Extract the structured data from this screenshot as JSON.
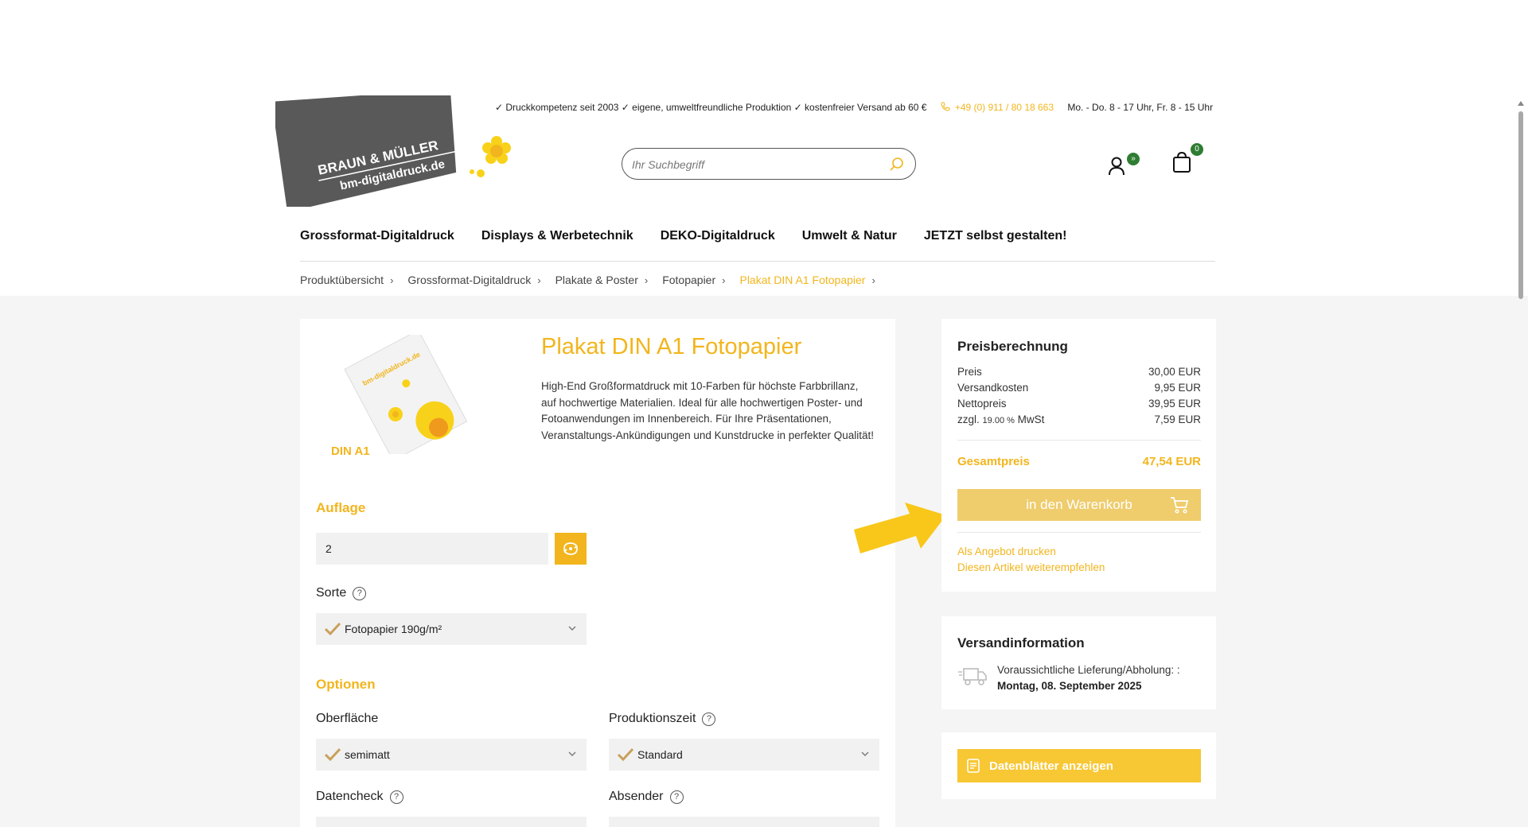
{
  "header": {
    "logo_line1": "BRAUN & MÜLLER",
    "logo_line2": "bm-digitaldruck.de",
    "tagline": "✓ Druckkompetenz seit 2003 ✓ eigene, umweltfreundliche Produktion ✓ kostenfreier Versand ab 60 €",
    "phone": "+49 (0) 911 / 80 18 663",
    "hours": "Mo. - Do. 8 - 17 Uhr, Fr. 8 - 15 Uhr",
    "search_placeholder": "Ihr Suchbegriff",
    "account_badge": "»",
    "cart_count": "0"
  },
  "nav": {
    "items": [
      "Grossformat-Digitaldruck",
      "Displays & Werbetechnik",
      "DEKO-Digitaldruck",
      "Umwelt & Natur",
      "JETZT selbst gestalten!"
    ]
  },
  "breadcrumb": {
    "items": [
      "Produktübersicht",
      "Grossformat-Digitaldruck",
      "Plakate & Poster",
      "Fotopapier",
      "Plakat DIN A1 Fotopapier"
    ]
  },
  "product": {
    "image_label": "DIN A1",
    "title": "Plakat DIN A1 Fotopapier",
    "description": "High-End Großformatdruck mit 10-Farben für höchste Farbbrillanz, auf hochwertige Materialien. Ideal für alle hochwertigen Poster- und Fotoanwendungen im Innenbereich. Für Ihre Präsentationen, Veranstaltungs-Ankündigungen und Kunstdrucke in perfekter Qualität!",
    "auflage_title": "Auflage",
    "auflage_value": "2",
    "sorte_label": "Sorte",
    "sorte_value": "Fotopapier 190g/m²",
    "optionen_title": "Optionen",
    "oberflaeche_label": "Oberfläche",
    "oberflaeche_value": "semimatt",
    "produktionszeit_label": "Produktionszeit",
    "produktionszeit_value": "Standard",
    "datencheck_label": "Datencheck",
    "absender_label": "Absender"
  },
  "price": {
    "title": "Preisberechnung",
    "rows": [
      {
        "label": "Preis",
        "value": "30,00 EUR"
      },
      {
        "label": "Versandkosten",
        "value": "9,95 EUR"
      },
      {
        "label": "Nettopreis",
        "value": "39,95 EUR"
      }
    ],
    "vat_prefix": "zzgl.",
    "vat_rate": "19.00 %",
    "vat_suffix": "MwSt",
    "vat_value": "7,59 EUR",
    "total_label": "Gesamtpreis",
    "total_value": "47,54 EUR",
    "cart_button": "in den Warenkorb",
    "link_offer": "Als Angebot drucken",
    "link_recommend": "Diesen Artikel weiterempfehlen"
  },
  "shipping": {
    "title": "Versandinformation",
    "label": "Voraussichtliche Lieferung/Abholung: :",
    "date": "Montag, 08. September 2025"
  },
  "datasheet": {
    "button": "Datenblätter anzeigen"
  },
  "colors": {
    "accent": "#f2b51d",
    "button_disabled": "#efcc6c",
    "badge_green": "#2e7d32"
  }
}
